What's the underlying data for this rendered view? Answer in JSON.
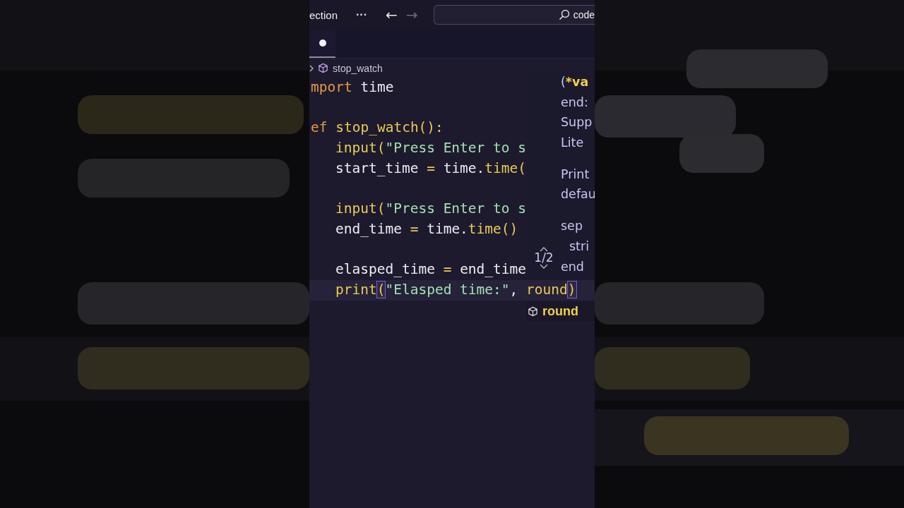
{
  "toolbar": {
    "menu_label": "ection",
    "more": "···",
    "nav": [
      {
        "glyph": "←",
        "disabled": false
      },
      {
        "glyph": "→",
        "disabled": true
      }
    ],
    "search": {
      "value": "code"
    }
  },
  "tabs": [
    {
      "modified": true,
      "selected": true
    }
  ],
  "breadcrumb": {
    "symbol": "stop_watch"
  },
  "code": [
    {
      "kind": "code",
      "indent": false,
      "current": false,
      "tokens": [
        {
          "t": "mport",
          "kind": "keyword"
        },
        {
          "t": " time",
          "kind": "plain"
        }
      ]
    },
    {
      "kind": "blank"
    },
    {
      "kind": "code",
      "indent": false,
      "current": false,
      "tokens": [
        {
          "t": "ef",
          "kind": "keyword"
        },
        {
          "t": " stop_watch():",
          "kind": "fn"
        }
      ]
    },
    {
      "kind": "code",
      "indent": true,
      "current": false,
      "tokens": [
        {
          "t": "input(",
          "kind": "fn"
        },
        {
          "t": "\"Press Enter to s",
          "kind": "string"
        }
      ]
    },
    {
      "kind": "code",
      "indent": true,
      "current": false,
      "tokens": [
        {
          "t": "start_time",
          "kind": "plain"
        },
        {
          "t": " = ",
          "kind": "op"
        },
        {
          "t": "time.",
          "kind": "plain"
        },
        {
          "t": "time(",
          "kind": "fn"
        }
      ]
    },
    {
      "kind": "blank"
    },
    {
      "kind": "code",
      "indent": true,
      "current": false,
      "tokens": [
        {
          "t": "input(",
          "kind": "fn"
        },
        {
          "t": "\"Press Enter to s",
          "kind": "string"
        }
      ]
    },
    {
      "kind": "code",
      "indent": true,
      "current": false,
      "tokens": [
        {
          "t": "end_time",
          "kind": "plain"
        },
        {
          "t": " = ",
          "kind": "op"
        },
        {
          "t": "time.",
          "kind": "plain"
        },
        {
          "t": "time()",
          "kind": "fn"
        }
      ]
    },
    {
      "kind": "blank"
    },
    {
      "kind": "code",
      "indent": true,
      "current": false,
      "tokens": [
        {
          "t": "elasped_time",
          "kind": "plain"
        },
        {
          "t": " = ",
          "kind": "op"
        },
        {
          "t": "end_time",
          "kind": "plain"
        }
      ]
    },
    {
      "kind": "code",
      "indent": true,
      "current": true,
      "tokens": [
        {
          "t": "print",
          "kind": "fn"
        },
        {
          "t": "(",
          "kind": "bracket"
        },
        {
          "t": "\"Elasped time:\"",
          "kind": "string"
        },
        {
          "t": ", ",
          "kind": "plain"
        },
        {
          "t": "round",
          "kind": "fn"
        },
        {
          "t": ")",
          "kind": "bracket"
        }
      ]
    }
  ],
  "hover": {
    "signature": {
      "open": "(",
      "param": "*va"
    },
    "sections": [
      {
        "lines": [
          "end:",
          "Supp",
          "Lite"
        ]
      },
      {
        "lines": [
          "Print",
          "defau"
        ]
      }
    ],
    "params": [
      {
        "name": "sep",
        "doc": "stri"
      },
      {
        "name": "end"
      }
    ],
    "counter": "1/2"
  },
  "suggestion": {
    "label": "round"
  }
}
